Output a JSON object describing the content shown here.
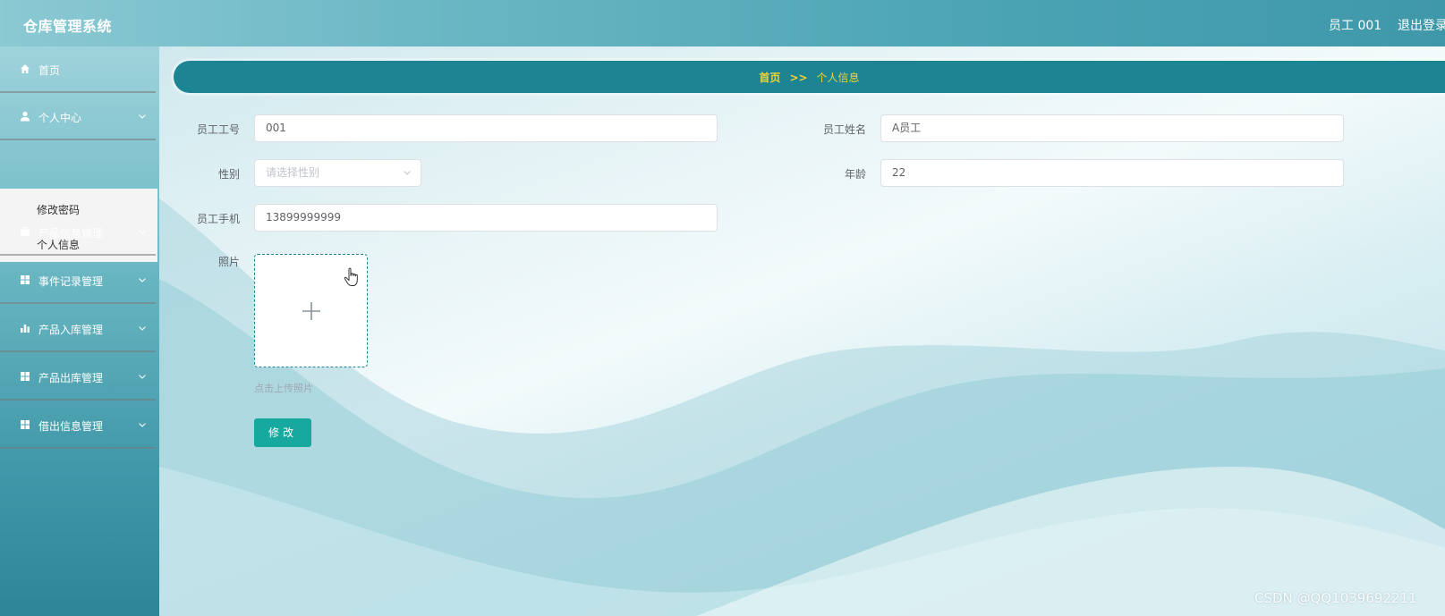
{
  "header": {
    "title": "仓库管理系统",
    "user": "员工 001",
    "logout": "退出登录"
  },
  "sidebar": {
    "items": [
      {
        "label": "首页",
        "icon": "home-icon"
      },
      {
        "label": "个人中心",
        "icon": "user-icon"
      },
      {
        "label": "产品信息管理",
        "icon": "briefcase-icon"
      },
      {
        "label": "事件记录管理",
        "icon": "grid-icon"
      },
      {
        "label": "产品入库管理",
        "icon": "bar-chart-icon"
      },
      {
        "label": "产品出库管理",
        "icon": "grid-icon"
      },
      {
        "label": "借出信息管理",
        "icon": "grid-icon"
      }
    ],
    "submenu": [
      {
        "label": "修改密码"
      },
      {
        "label": "个人信息"
      }
    ]
  },
  "breadcrumb": {
    "home": "首页",
    "separator": ">>",
    "current": "个人信息"
  },
  "form": {
    "employee_id": {
      "label": "员工工号",
      "value": "001"
    },
    "employee_name": {
      "label": "员工姓名",
      "value": "A员工"
    },
    "gender": {
      "label": "性别",
      "placeholder": "请选择性别"
    },
    "age": {
      "label": "年龄",
      "value": "22"
    },
    "phone": {
      "label": "员工手机",
      "value": "13899999999"
    },
    "photo": {
      "label": "照片",
      "tip": "点击上传照片"
    },
    "submit_label": "修改"
  },
  "watermark": "CSDN @QQ1039692211",
  "colors": {
    "breadcrumb_bg": "#1c8493",
    "breadcrumb_text": "#f2d233",
    "submit_button": "#17a9a0"
  }
}
